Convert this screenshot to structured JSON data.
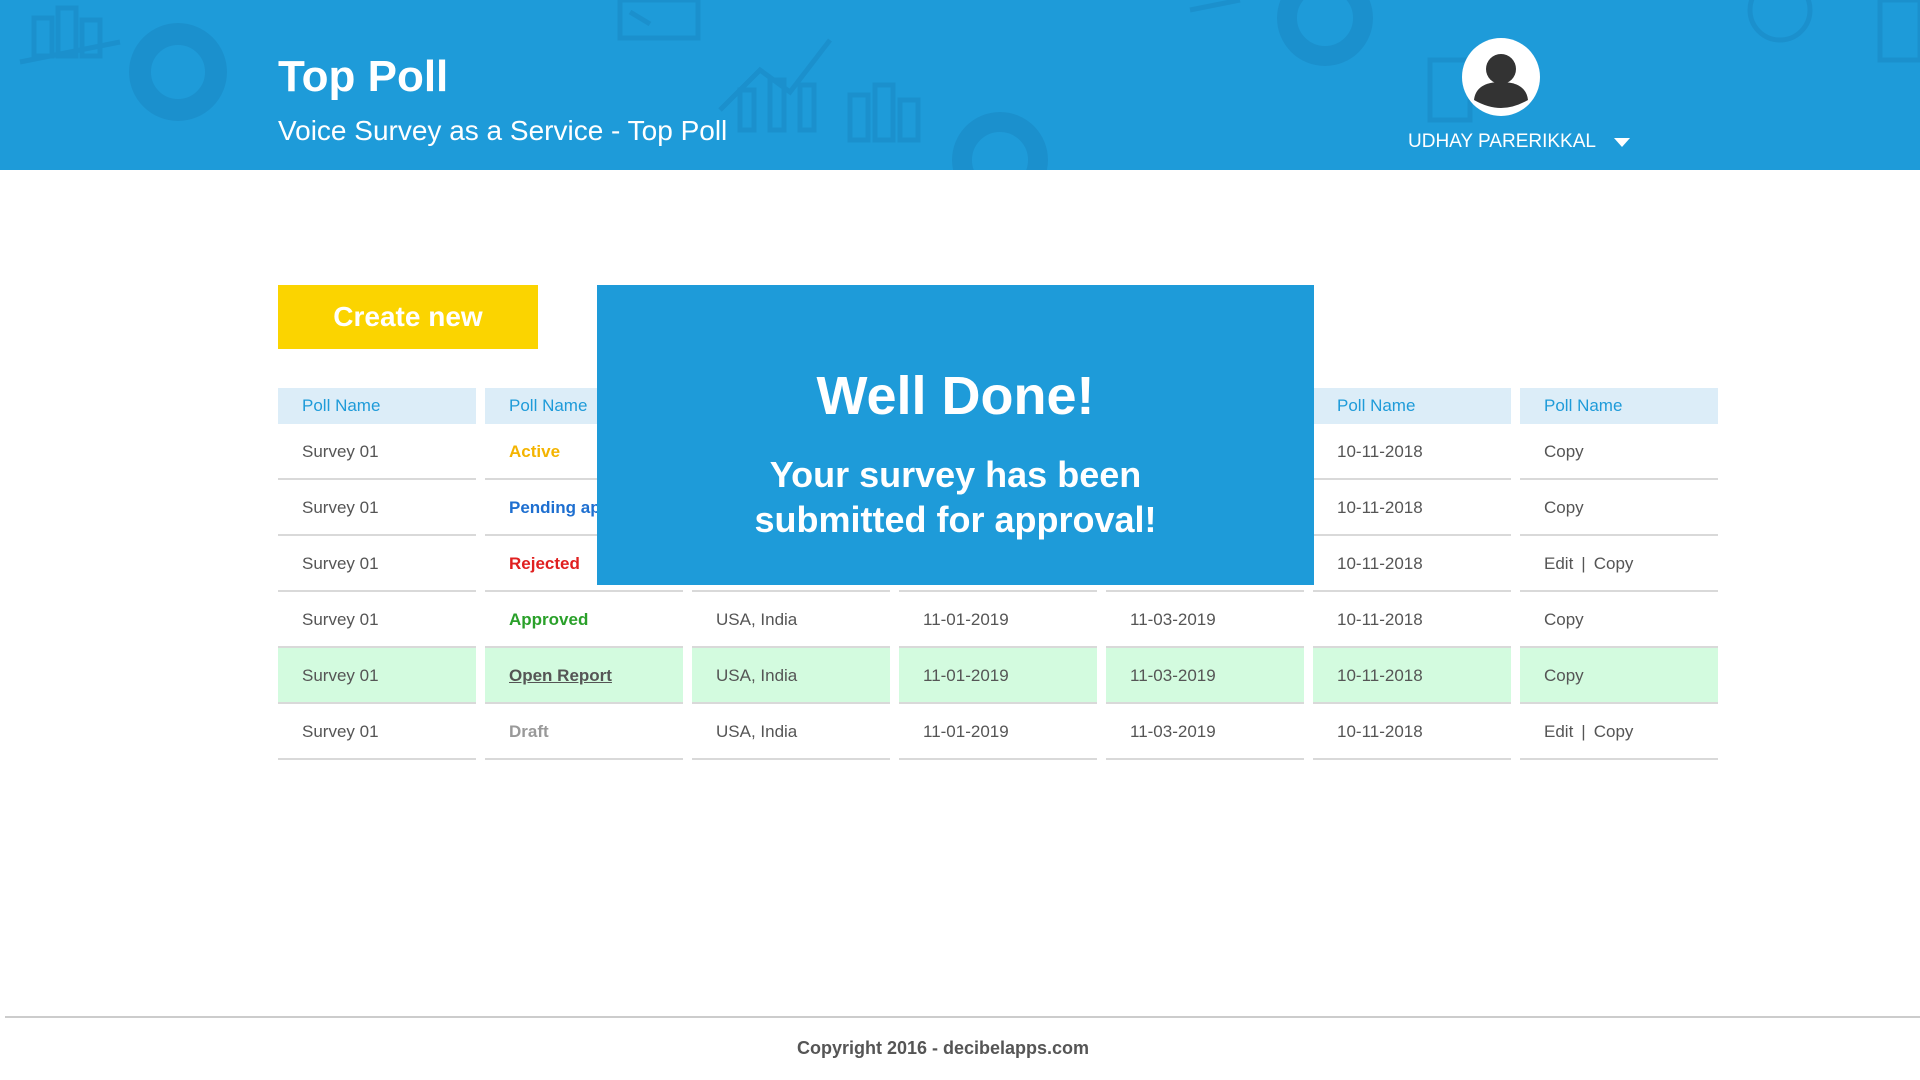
{
  "header": {
    "title": "Top Poll",
    "subtitle": "Voice Survey as a Service - Top Poll",
    "user_name": "UDHAY PARERIKKAL",
    "background_color": "#1e9bd9"
  },
  "create_button": {
    "label": "Create new",
    "color": "#fbd400"
  },
  "table": {
    "headers": [
      "Poll Name",
      "Poll Name",
      "",
      "",
      "",
      "Poll Name",
      "Poll Name"
    ],
    "rows": [
      [
        "Survey 01",
        "Active",
        "",
        "",
        "",
        "10-11-2018",
        "Copy"
      ],
      [
        "Survey 01",
        "Pending ap",
        "",
        "",
        "",
        "10-11-2018",
        "Copy"
      ],
      [
        "Survey 01",
        "Rejected",
        "",
        "",
        "",
        "10-11-2018",
        "Edit",
        "Copy"
      ],
      [
        "Survey 01",
        "Approved",
        "USA, India",
        "11-01-2019",
        "11-03-2019",
        "10-11-2018",
        "Copy"
      ],
      [
        "Survey 01",
        "Open Report",
        "USA, India",
        "11-01-2019",
        "11-03-2019",
        "10-11-2018",
        "Copy"
      ],
      [
        "Survey 01",
        "Draft",
        "USA, India",
        "11-01-2019",
        "11-03-2019",
        "10-11-2018",
        "Edit",
        "Copy"
      ]
    ],
    "action_separator": "|",
    "highlight_color": "#d3fbdf"
  },
  "modal": {
    "title": "Well Done!",
    "message_line1": "Your survey has been",
    "message_line2": "submitted for approval!"
  },
  "footer": {
    "copyright": "Copyright 2016 - decibelapps.com"
  }
}
